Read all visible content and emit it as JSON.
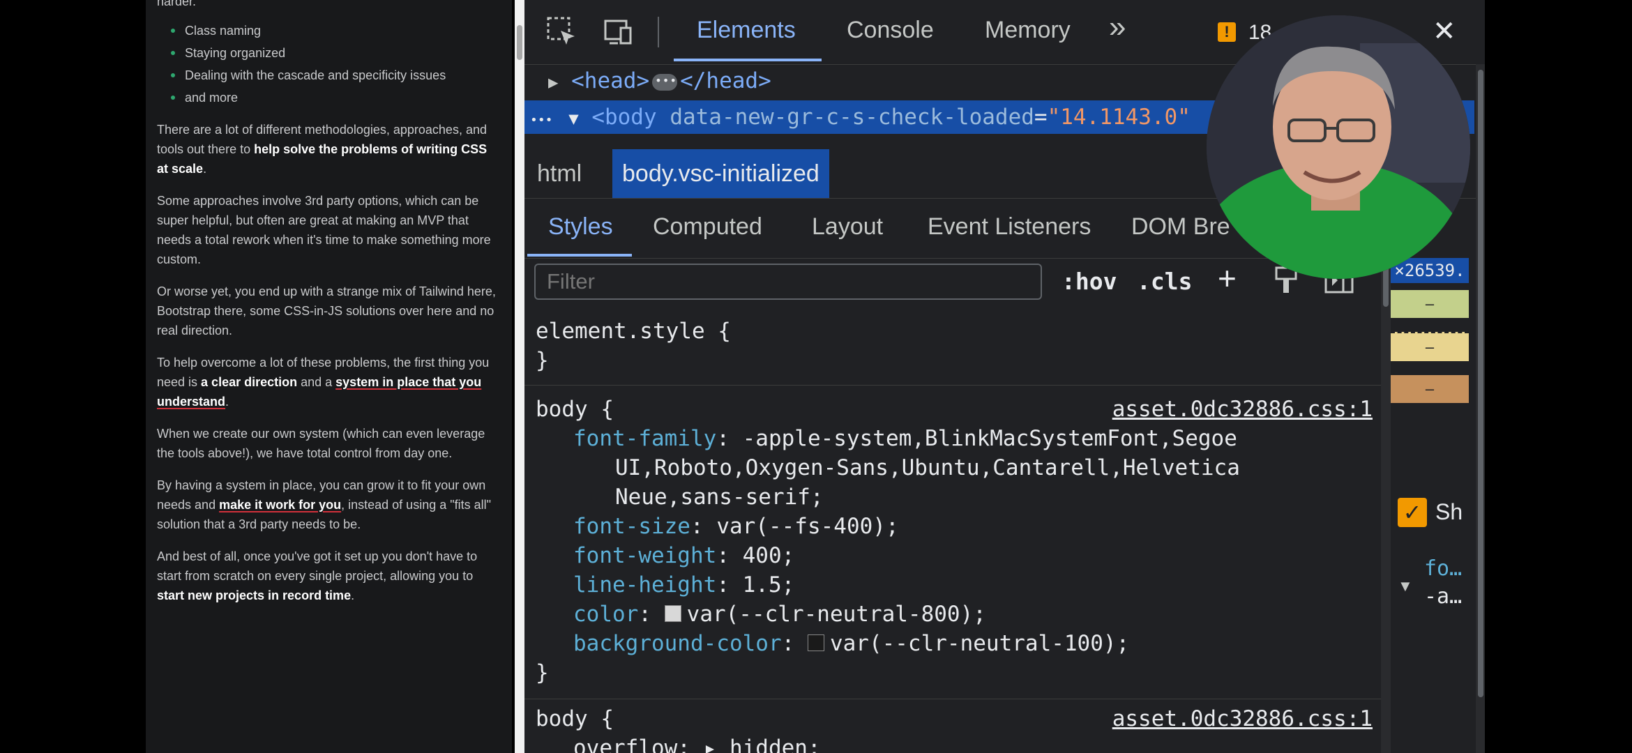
{
  "page": {
    "truncated_top": "harder.",
    "bullets": [
      "Class naming",
      "Staying organized",
      "Dealing with the cascade and specificity issues",
      "and more"
    ],
    "p1": {
      "pre": "There are a lot of different methodologies, approaches, and tools out there to ",
      "bold": "help solve the problems of writing CSS at scale",
      "post": "."
    },
    "p2": "Some approaches involve 3rd party options, which can be super helpful, but often are great at making an MVP that needs a total rework when it's time to make something more custom.",
    "p3": "Or worse yet, you end up with a strange mix of Tailwind here, Bootstrap there, some CSS-in-JS solutions over here and no real direction.",
    "p4": {
      "pre": "To help overcome a lot of these problems, the first thing you need is ",
      "bold1": "a clear direction",
      "mid": " and a ",
      "bold2": "system in place that you understand",
      "post": "."
    },
    "p5": "When we create our own system (which can even leverage the tools above!), we have total control from day one.",
    "p6": {
      "pre": "By having a system in place, you can grow it to fit your own needs and ",
      "bold": "make it work for you",
      "post": ", instead of using a \"fits all\" solution that a 3rd party needs to be."
    },
    "p7": {
      "pre": "And best of all, once you've got it set up you don't have to start from scratch on every single project, allowing you to ",
      "bold": "start new projects in record time",
      "post": "."
    }
  },
  "devtools": {
    "tabs": [
      "Elements",
      "Console",
      "Memory"
    ],
    "more_tabs": "»",
    "issues_count": "18",
    "close": "✕",
    "dom": {
      "head_open": "<head>",
      "head_close": "</head>",
      "body_tag": "<body",
      "body_attr": "data-new-gr-c-s-check-loaded",
      "body_eq": "=",
      "body_attrval": "\"14.1143.0\"",
      "row_dots": "•••"
    },
    "breadcrumbs": [
      "html",
      "body.vsc-initialized"
    ],
    "subtabs": [
      "Styles",
      "Computed",
      "Layout",
      "Event Listeners",
      "DOM Bre"
    ],
    "filter_placeholder": "Filter",
    "hov": ":hov",
    "cls": ".cls",
    "plus": "+",
    "element_style": {
      "selector": "element.style {",
      "close": "}"
    },
    "rule1": {
      "selector": "body {",
      "source": "asset.0dc32886.css:1",
      "decls": [
        {
          "prop": "font-family",
          "val": "-apple-system,BlinkMacSystemFont,Segoe"
        },
        {
          "prop": "",
          "val": "UI,Roboto,Oxygen-Sans,Ubuntu,Cantarell,Helvetica"
        },
        {
          "prop": "",
          "val": "Neue,sans-serif;"
        },
        {
          "prop": "font-size",
          "val": "var(--fs-400);"
        },
        {
          "prop": "font-weight",
          "val": "400;"
        },
        {
          "prop": "line-height",
          "val": "1.5;"
        },
        {
          "prop": "color",
          "val": "var(--clr-neutral-800);"
        },
        {
          "prop": "background-color",
          "val": "var(--clr-neutral-100);"
        }
      ],
      "close": "}"
    },
    "rule2": {
      "selector": "body {",
      "source": "asset.0dc32886.css:1",
      "partial": "overflow: ▸ hidden;"
    },
    "side": {
      "dim": "×26539.",
      "dash": "–",
      "checkbox_label": "Sh",
      "fo": "fo…",
      "a": "-a…"
    },
    "colors": {
      "accent": "#8ab4f8",
      "selection": "#174ea6",
      "prop": "#5db0d7",
      "bg": "#202124"
    }
  }
}
